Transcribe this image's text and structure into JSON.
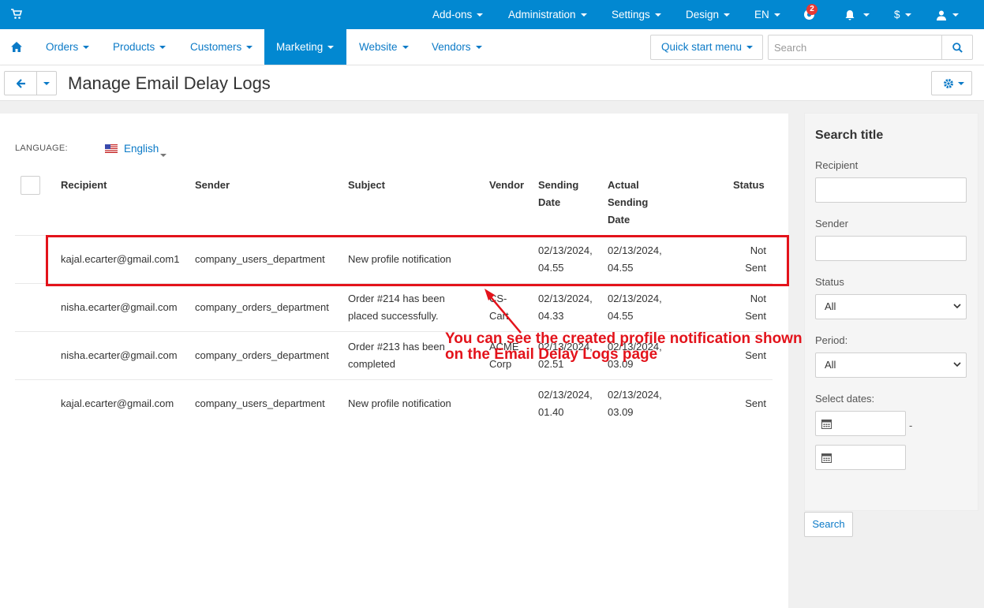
{
  "topbar": {
    "menus": [
      {
        "label": "Add-ons"
      },
      {
        "label": "Administration"
      },
      {
        "label": "Settings"
      },
      {
        "label": "Design"
      },
      {
        "label": "EN"
      }
    ],
    "notification_count": "2",
    "currency": "$"
  },
  "nav": {
    "items": [
      {
        "label": "Orders"
      },
      {
        "label": "Products"
      },
      {
        "label": "Customers"
      },
      {
        "label": "Marketing"
      },
      {
        "label": "Website"
      },
      {
        "label": "Vendors"
      }
    ],
    "quick_start_label": "Quick start menu",
    "search_placeholder": "Search"
  },
  "page": {
    "title": "Manage Email Delay Logs"
  },
  "language": {
    "label": "LANGUAGE:",
    "value": "English"
  },
  "table": {
    "headers": {
      "recipient": "Recipient",
      "sender": "Sender",
      "subject": "Subject",
      "vendor": "Vendor",
      "sending_date_1": "Sending",
      "sending_date_2": "Date",
      "actual_1": "Actual",
      "actual_2": "Sending",
      "actual_3": "Date",
      "status": "Status"
    },
    "rows": [
      {
        "recipient": "kajal.ecarter@gmail.com1",
        "sender": "company_users_department",
        "subject_1": "New profile notification",
        "subject_2": "",
        "vendor_1": "",
        "vendor_2": "",
        "sending_1": "02/13/2024,",
        "sending_2": "04.55",
        "actual_1": "02/13/2024,",
        "actual_2": "04.55",
        "status_1": "Not",
        "status_2": "Sent"
      },
      {
        "recipient": "nisha.ecarter@gmail.com",
        "sender": "company_orders_department",
        "subject_1": "Order #214 has been",
        "subject_2": "placed successfully.",
        "vendor_1": "CS-",
        "vendor_2": "Cart",
        "sending_1": "02/13/2024,",
        "sending_2": "04.33",
        "actual_1": "02/13/2024,",
        "actual_2": "04.55",
        "status_1": "Not",
        "status_2": "Sent"
      },
      {
        "recipient": "nisha.ecarter@gmail.com",
        "sender": "company_orders_department",
        "subject_1": "Order #213 has been",
        "subject_2": "completed",
        "vendor_1": "ACME",
        "vendor_2": "Corp",
        "sending_1": "02/13/2024,",
        "sending_2": "02.51",
        "actual_1": "02/13/2024,",
        "actual_2": "03.09",
        "status_1": "",
        "status_2": "Sent"
      },
      {
        "recipient": "kajal.ecarter@gmail.com",
        "sender": "company_users_department",
        "subject_1": "New profile notification",
        "subject_2": "",
        "vendor_1": "",
        "vendor_2": "",
        "sending_1": "02/13/2024,",
        "sending_2": "01.40",
        "actual_1": "02/13/2024,",
        "actual_2": "03.09",
        "status_1": "",
        "status_2": "Sent"
      }
    ]
  },
  "annotation": {
    "line1": "You can see the created profile notification shown",
    "line2": "on the Email Delay Logs page",
    "color": "#e3131b"
  },
  "sidebar": {
    "title": "Search title",
    "recipient_label": "Recipient",
    "sender_label": "Sender",
    "status_label": "Status",
    "status_value": "All",
    "period_label": "Period:",
    "period_value": "All",
    "dates_label": "Select dates:",
    "dash": "-",
    "search_button": "Search"
  },
  "colors": {
    "brand": "#0288d1",
    "link": "#0b7ac7"
  }
}
